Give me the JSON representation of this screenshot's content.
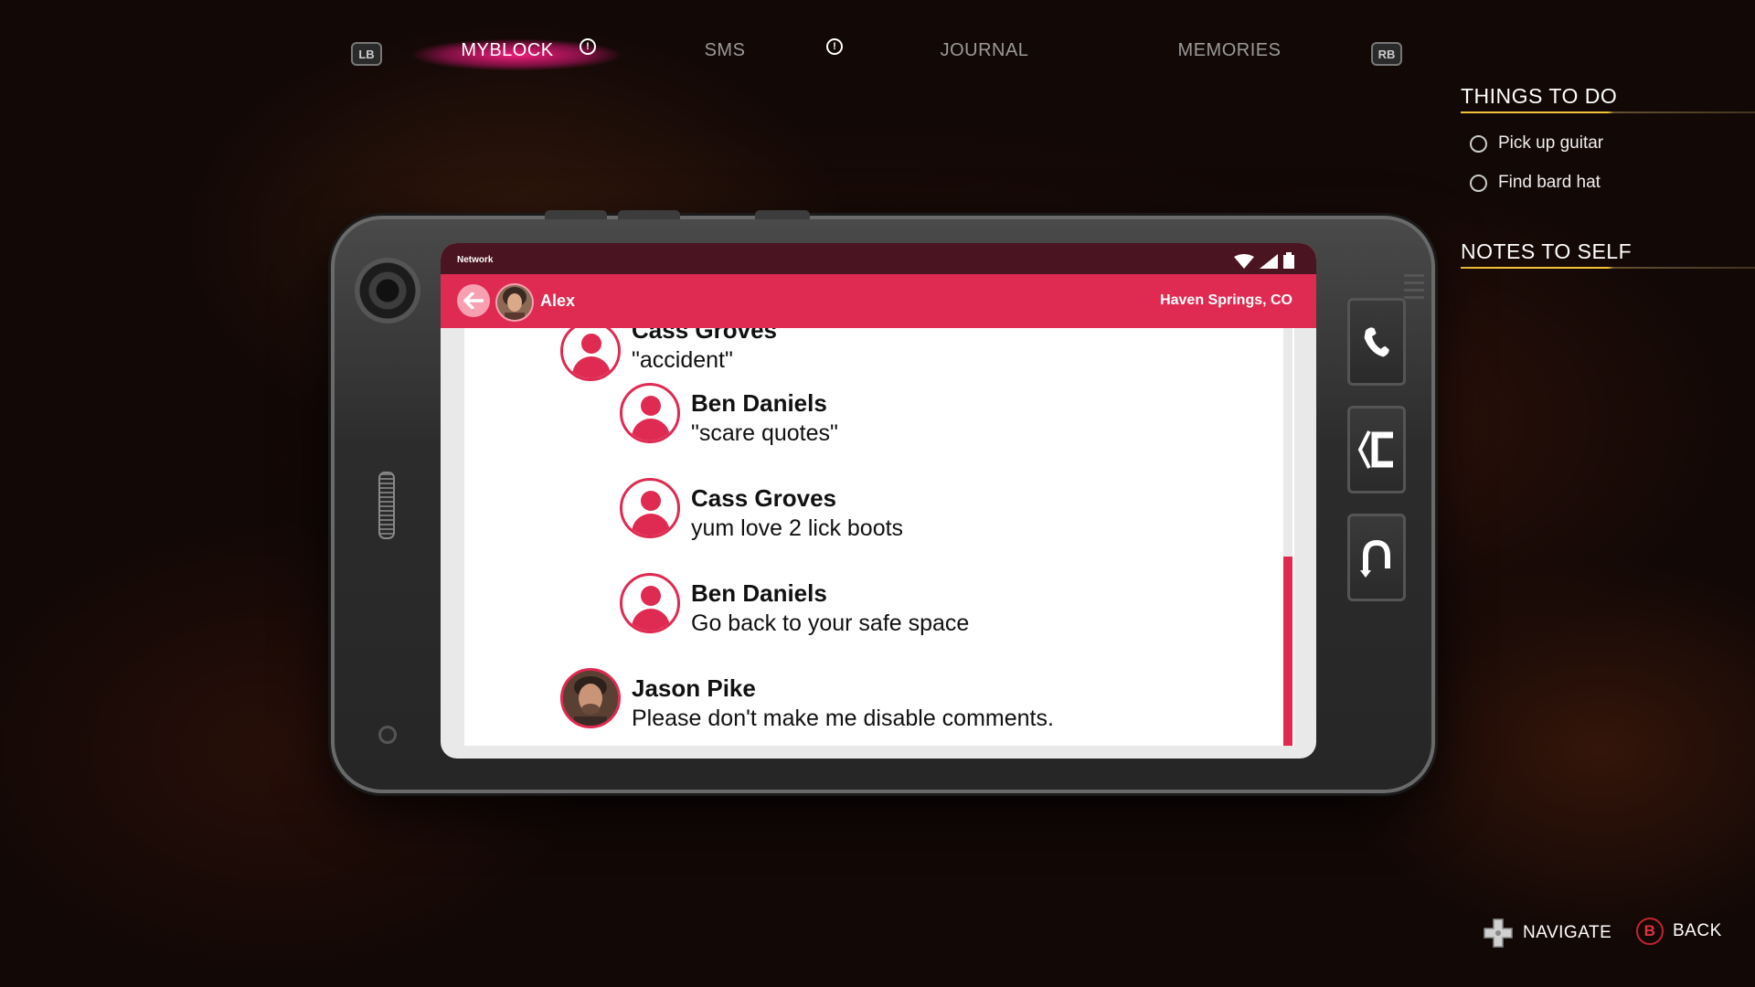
{
  "tabs": {
    "lb_label": "LB",
    "rb_label": "RB",
    "items": [
      {
        "label": "MYBLOCK",
        "active": true,
        "alert": true
      },
      {
        "label": "SMS",
        "active": false,
        "alert": true
      },
      {
        "label": "JOURNAL",
        "active": false,
        "alert": false
      },
      {
        "label": "MEMORIES",
        "active": false,
        "alert": false
      }
    ],
    "alert_glyph": "!"
  },
  "side_panel": {
    "things_to_do_heading": "THINGS TO DO",
    "todos": [
      "Pick up guitar",
      "Find bard hat"
    ],
    "notes_heading": "NOTES TO SELF"
  },
  "phone": {
    "status": {
      "network_label": "Network"
    },
    "appbar": {
      "contact_name": "Alex",
      "location": "Haven Springs, CO"
    },
    "comments": [
      {
        "name": "Cass Groves",
        "message": "\"accident\"",
        "avatar": "default-user-icon",
        "reply": false
      },
      {
        "name": "Ben Daniels",
        "message": "\"scare quotes\"",
        "avatar": "default-user-icon",
        "reply": true
      },
      {
        "name": "Cass Groves",
        "message": "yum love 2 lick boots",
        "avatar": "default-user-icon",
        "reply": true
      },
      {
        "name": "Ben Daniels",
        "message": "Go back to your safe space",
        "avatar": "default-user-icon",
        "reply": true
      },
      {
        "name": "Jason Pike",
        "message": "Please don't make me disable comments.",
        "avatar": "photo",
        "reply": false
      }
    ],
    "scroll_position": 0.55,
    "side_buttons": [
      "phone-icon",
      "reply-icon",
      "horseshoe-icon"
    ]
  },
  "hints": {
    "navigate_label": "NAVIGATE",
    "back_label": "BACK",
    "back_button_glyph": "B"
  },
  "colors": {
    "accent": "#df2a51",
    "status_bar": "#4a1420",
    "tab_glow": "#ff1e82",
    "rule": "#f2c23a"
  }
}
